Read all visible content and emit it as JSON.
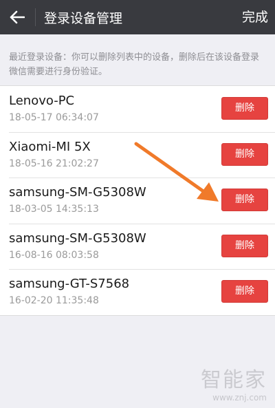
{
  "header": {
    "title": "登录设备管理",
    "done_label": "完成",
    "back_icon": "arrow-left-icon"
  },
  "hint": "最近登录设备：你可以删除列表中的设备，删除后在该设备登录微信需要进行身份验证。",
  "devices": [
    {
      "name": "Lenovo-PC",
      "time": "18-05-17 06:34:07",
      "delete_label": "删除"
    },
    {
      "name": "Xiaomi-MI 5X",
      "time": "18-05-16 21:02:27",
      "delete_label": "删除"
    },
    {
      "name": "samsung-SM-G5308W",
      "time": "18-03-05 14:35:13",
      "delete_label": "删除"
    },
    {
      "name": "samsung-SM-G5308W",
      "time": "16-08-16 08:03:58",
      "delete_label": "删除"
    },
    {
      "name": "samsung-GT-S7568",
      "time": "16-02-20 11:35:48",
      "delete_label": "删除"
    }
  ],
  "watermark": {
    "logo": "智能家",
    "url": "www.znj.com"
  },
  "colors": {
    "topbar": "#393a3f",
    "delete_button": "#e64340",
    "annotation_arrow": "#f07a2a",
    "background": "#efeff4"
  }
}
